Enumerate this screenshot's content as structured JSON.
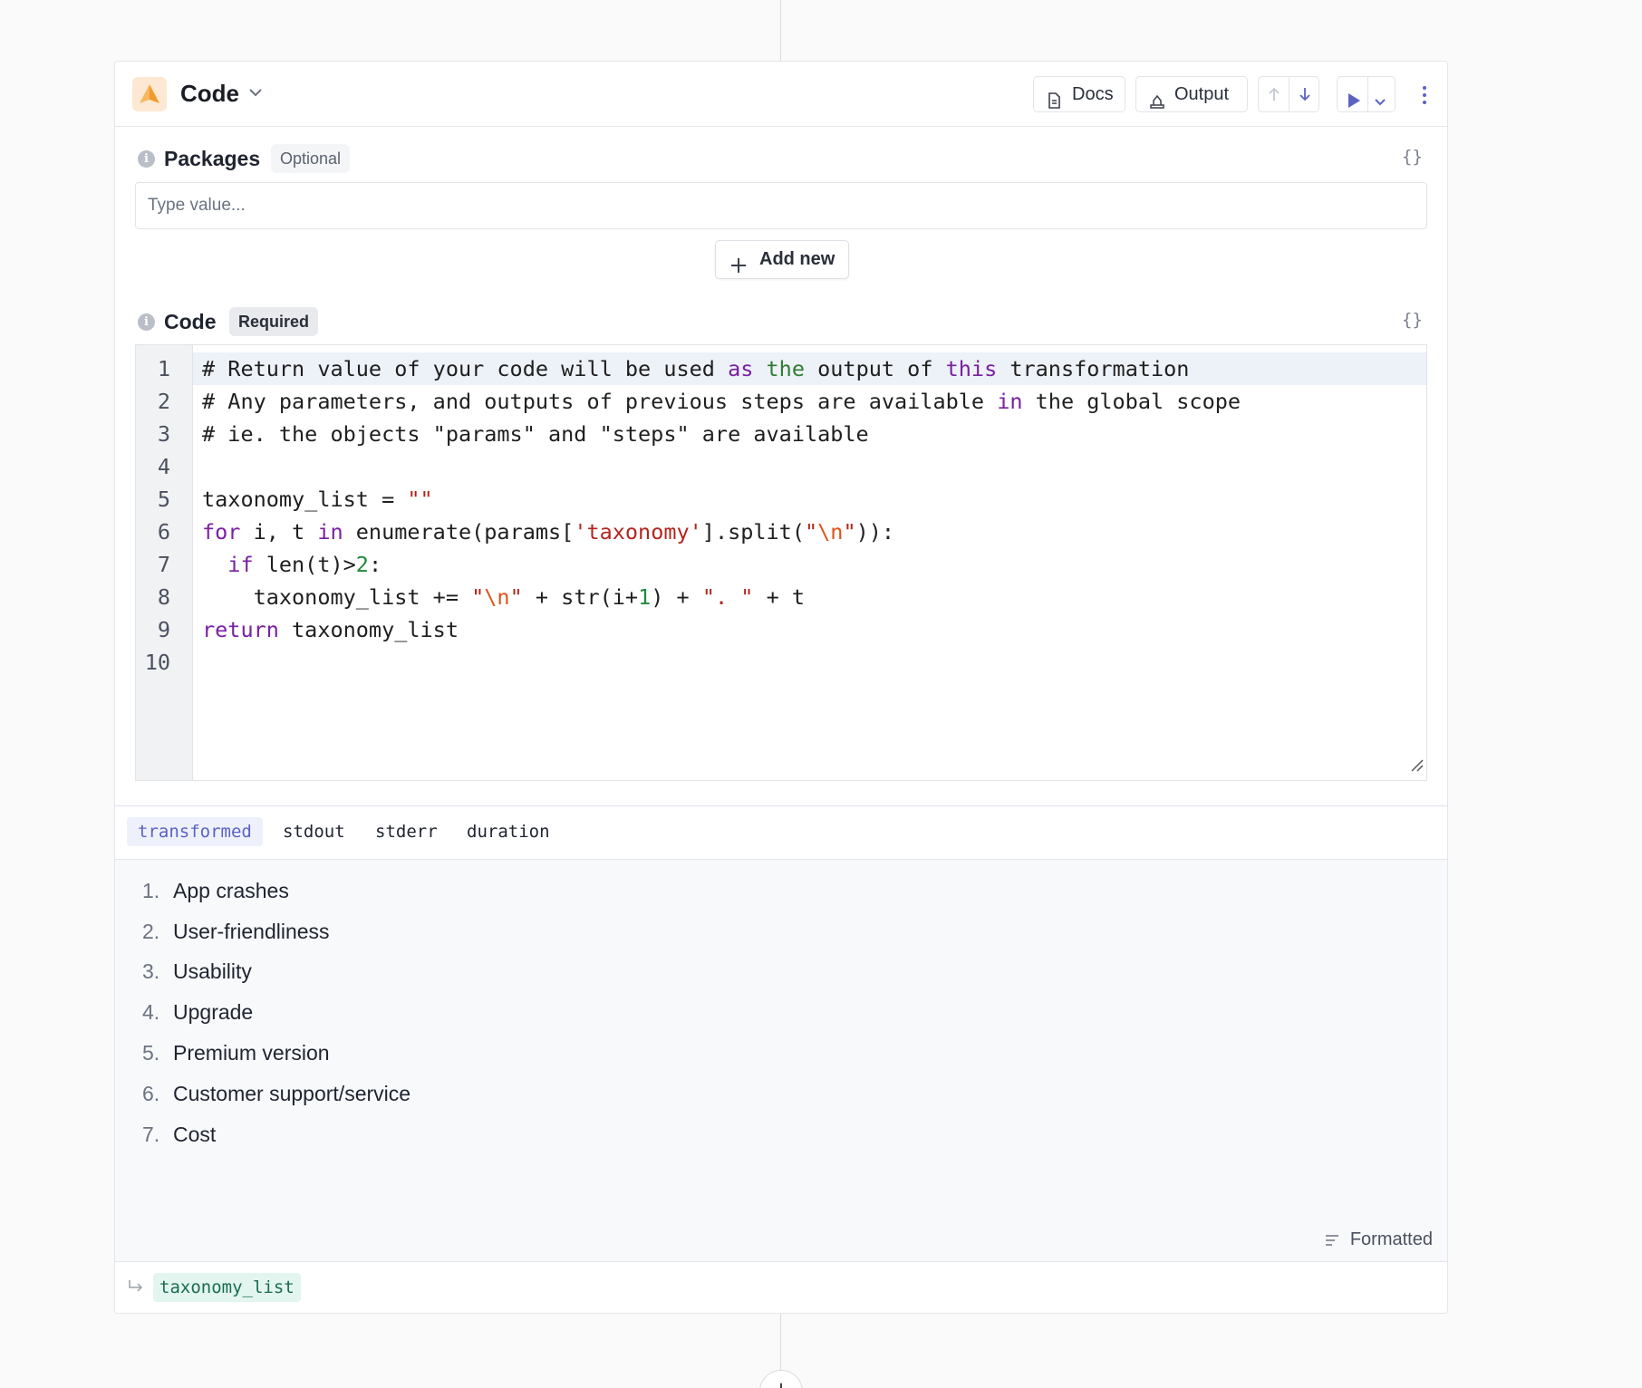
{
  "step": {
    "title": "Code",
    "actions": {
      "docs_label": "Docs",
      "output_label": "Output"
    }
  },
  "packages": {
    "label": "Packages",
    "badge": "Optional",
    "placeholder": "Type value...",
    "add_label": "Add new",
    "braces": "{}"
  },
  "code_field": {
    "label": "Code",
    "badge": "Required",
    "braces": "{}",
    "line_numbers": [
      "1",
      "2",
      "3",
      "4",
      "5",
      "6",
      "7",
      "8",
      "9",
      "10"
    ],
    "lines": [
      "# Return value of your code will be used as the output of this transformation",
      "# Any parameters, and outputs of previous steps are available in the global scope",
      "# ie. the objects \"params\" and \"steps\" are available",
      "",
      "taxonomy_list = \"\"",
      "for i, t in enumerate(params['taxonomy'].split(\"\\n\")):",
      "  if len(t)>2:",
      "    taxonomy_list += \"\\n\" + str(i+1) + \". \" + t",
      "return taxonomy_list",
      ""
    ]
  },
  "output_tabs": [
    "transformed",
    "stdout",
    "stderr",
    "duration"
  ],
  "active_tab": "transformed",
  "output_items": [
    {
      "num": "1.",
      "text": "App crashes"
    },
    {
      "num": "2.",
      "text": "User-friendliness"
    },
    {
      "num": "3.",
      "text": "Usability"
    },
    {
      "num": "4.",
      "text": "Upgrade"
    },
    {
      "num": "5.",
      "text": "Premium version"
    },
    {
      "num": "6.",
      "text": "Customer support/service"
    },
    {
      "num": "7.",
      "text": "Cost"
    }
  ],
  "formatted_label": "Formatted",
  "export_variable": "taxonomy_list",
  "colors": {
    "accent": "#5a62c4",
    "keyword": "#7a1fa2",
    "string": "#b3261e",
    "export_tag_bg": "#e2f6ef"
  },
  "icons": [
    "code-app-icon",
    "chevron-down-icon",
    "document-icon",
    "output-icon",
    "arrow-up-icon",
    "arrow-down-icon",
    "play-icon",
    "more-vertical-icon",
    "info-icon",
    "braces-icon",
    "plus-icon",
    "resize-handle-icon",
    "formatted-lines-icon",
    "export-arrow-icon"
  ]
}
